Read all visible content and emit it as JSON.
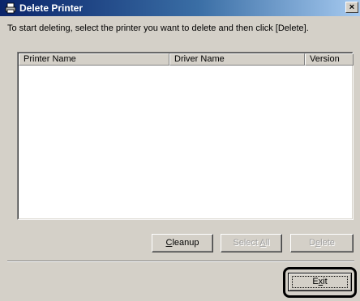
{
  "window": {
    "title": "Delete Printer",
    "close_label": "×"
  },
  "instruction": "To start deleting, select the printer you want to delete and then click [Delete].",
  "list": {
    "columns": [
      "Printer Name",
      "Driver Name",
      "Version"
    ],
    "rows": []
  },
  "buttons": {
    "cleanup": {
      "pre": "",
      "mnemonic": "C",
      "post": "leanup",
      "enabled": true
    },
    "select_all": {
      "pre": "Select ",
      "mnemonic": "A",
      "post": "ll",
      "enabled": false
    },
    "delete": {
      "pre": "D",
      "mnemonic": "e",
      "post": "lete",
      "enabled": false
    },
    "exit": {
      "pre": "E",
      "mnemonic": "x",
      "post": "it",
      "enabled": true,
      "focused": true,
      "highlighted": true
    }
  }
}
